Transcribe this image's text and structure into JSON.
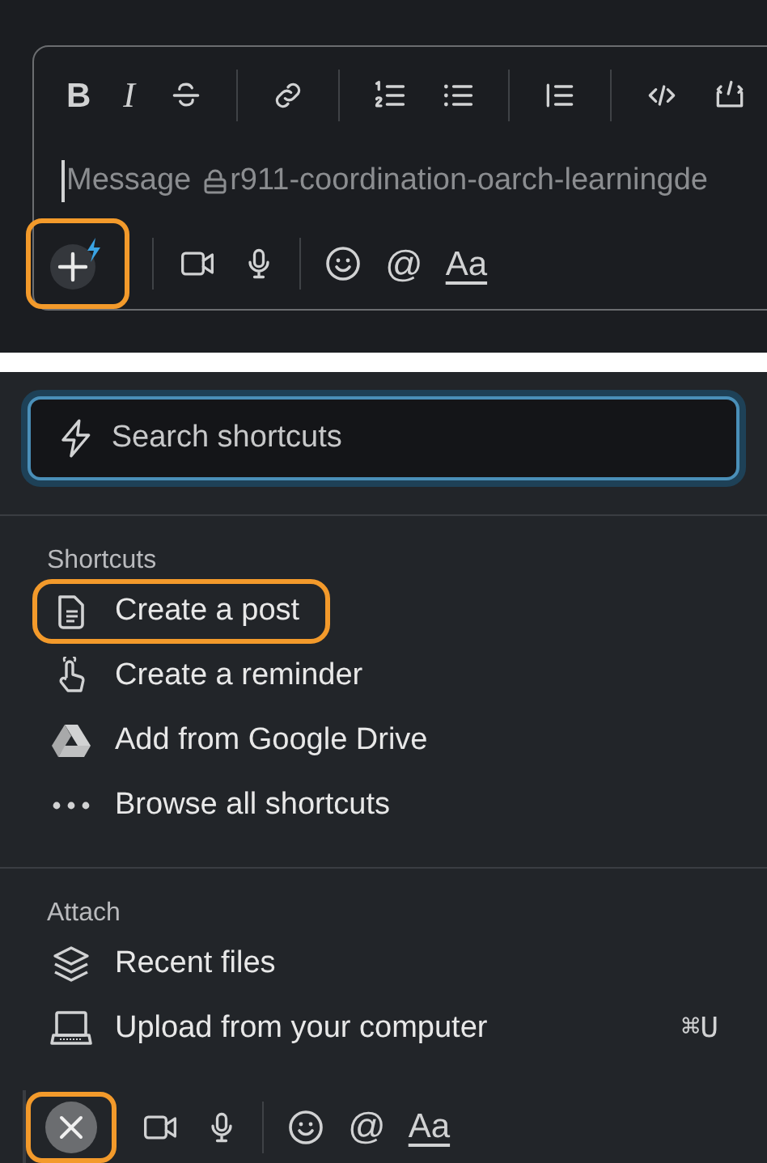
{
  "composer": {
    "format_toolbar": [
      {
        "kind": "bold",
        "label": "B"
      },
      {
        "kind": "italic",
        "label": "I"
      },
      {
        "kind": "strike"
      },
      {
        "kind": "sep"
      },
      {
        "kind": "link"
      },
      {
        "kind": "sep"
      },
      {
        "kind": "ordered"
      },
      {
        "kind": "bullets"
      },
      {
        "kind": "sep"
      },
      {
        "kind": "quote"
      },
      {
        "kind": "sep"
      },
      {
        "kind": "code"
      },
      {
        "kind": "codeblock"
      }
    ],
    "message_field": {
      "placeholder": "Message",
      "private": true,
      "channel": "r911-coordination-oarch-learningde"
    },
    "actions": [
      {
        "kind": "shortcuts",
        "highlighted": true
      },
      {
        "kind": "sep"
      },
      {
        "kind": "video"
      },
      {
        "kind": "mic"
      },
      {
        "kind": "sep"
      },
      {
        "kind": "emoji"
      },
      {
        "kind": "mention",
        "label": "@"
      },
      {
        "kind": "format",
        "label": "Aa"
      }
    ]
  },
  "menu": {
    "search": {
      "placeholder": "Search shortcuts"
    },
    "sections": [
      {
        "title": "Shortcuts",
        "items": [
          {
            "kind": "post",
            "label": "Create a post",
            "highlighted": true
          },
          {
            "kind": "reminder",
            "label": "Create a reminder",
            "highlighted": false
          },
          {
            "kind": "drive",
            "label": "Add from Google Drive",
            "highlighted": false
          },
          {
            "kind": "more",
            "label": "Browse all shortcuts",
            "highlighted": false
          }
        ]
      },
      {
        "title": "Attach",
        "items": [
          {
            "kind": "layers",
            "label": "Recent files",
            "highlighted": false
          },
          {
            "kind": "laptop",
            "label": "Upload from your computer",
            "shortcut": "⌘U",
            "highlighted": false
          }
        ]
      }
    ],
    "actions": [
      {
        "kind": "close",
        "highlighted": true
      },
      {
        "kind": "video"
      },
      {
        "kind": "mic"
      },
      {
        "kind": "sep"
      },
      {
        "kind": "emoji"
      },
      {
        "kind": "mention",
        "label": "@"
      },
      {
        "kind": "format",
        "label": "Aa"
      }
    ]
  }
}
